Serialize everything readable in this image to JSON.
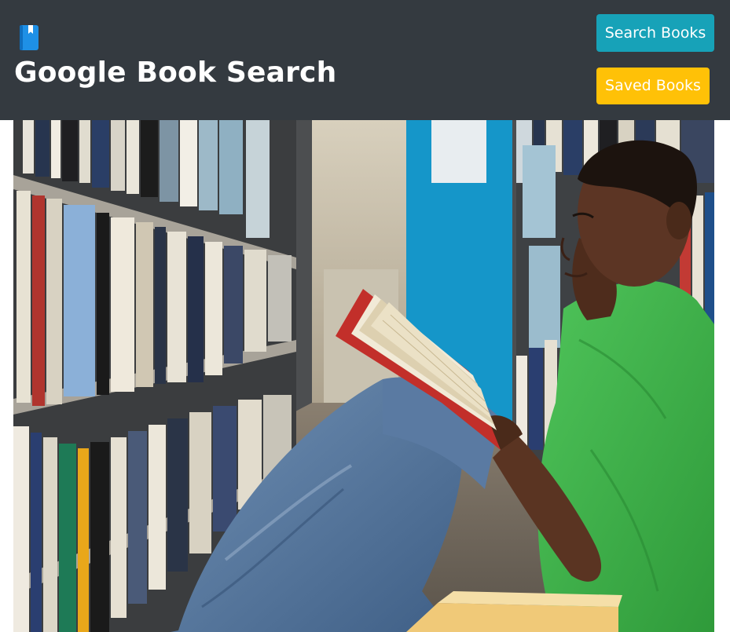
{
  "header": {
    "icon": "book-icon",
    "title": "Google Book Search"
  },
  "nav": {
    "search_label": "Search Books",
    "saved_label": "Saved Books"
  },
  "hero": {
    "image": "student-reading-in-library-photo"
  },
  "colors": {
    "navbar_bg": "#343a40",
    "search_button": "#17a2b8",
    "saved_button": "#ffc107",
    "icon_blue": "#1e90e6"
  }
}
